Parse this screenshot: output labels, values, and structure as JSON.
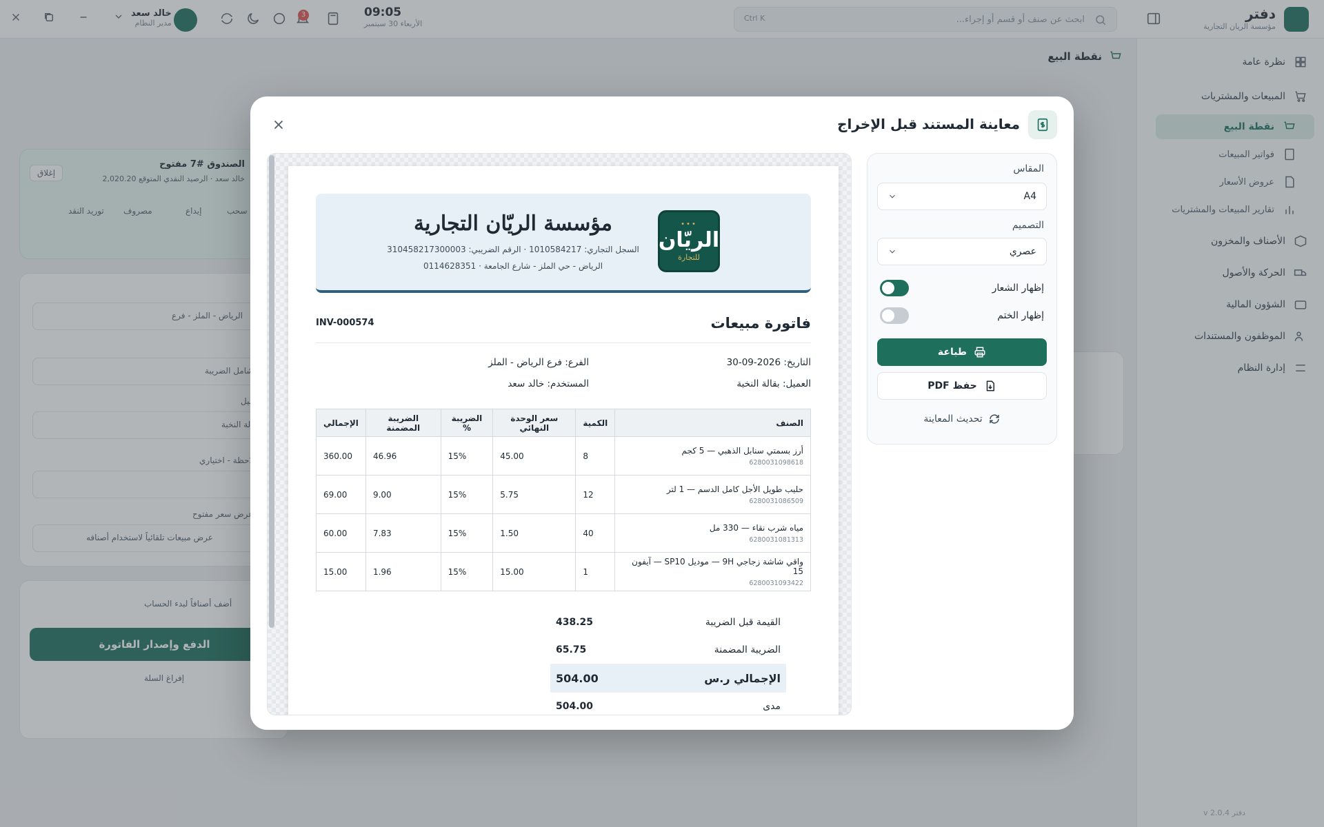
{
  "app": {
    "brand_name": "دفتر",
    "brand_sub": "مؤسسة الريان التجارية",
    "search_placeholder": "ابحث عن صنف أو قسم أو إجراء...",
    "search_shortcut": "Ctrl K",
    "clock_time": "09:05",
    "clock_date": "الأربعاء 30 سبتمبر",
    "user_name": "خالد سعد",
    "user_role": "مدير النظام",
    "notification_count": "3",
    "version": "v 2.0.4 دفتر"
  },
  "sidebar": {
    "items": [
      {
        "label": "نظرة عامة",
        "icon": "grid-icon"
      },
      {
        "label": "المبيعات والمشتريات",
        "icon": "cart-icon"
      },
      {
        "label": "نقطة البيع",
        "icon": "cart-icon"
      },
      {
        "label": "فواتير المبيعات",
        "icon": "receipt-icon"
      },
      {
        "label": "عروض الأسعار",
        "icon": "document-icon"
      },
      {
        "label": "تقارير المبيعات والمشتريات",
        "icon": "bar-chart-icon"
      },
      {
        "label": "الأصناف والمخزون",
        "icon": "box-icon"
      },
      {
        "label": "الحركة والأصول",
        "icon": "truck-icon"
      },
      {
        "label": "الشؤون المالية",
        "icon": "wallet-icon"
      },
      {
        "label": "الموظفون والمستندات",
        "icon": "users-icon"
      },
      {
        "label": "إدارة النظام",
        "icon": "sliders-icon"
      }
    ]
  },
  "background": {
    "page_title": "نقطة البيع",
    "cash_box_title": "الصندوق #7 مفتوح",
    "cash_box_sub": "خالد سعد · الرصيد النقدي المتوقع 2,020.20",
    "lock_label": "إغلاق",
    "actions": [
      "توريد النقد",
      "مصروف",
      "إيداع",
      "سحب"
    ],
    "branch_value": "الرياض - الملز - فرع",
    "tax_label": "شامل الضريبة",
    "customer_label": "العميل",
    "customer_value": "بقالة النخبة",
    "note_label": "ملاحظة - اختياري",
    "price_level": "عرض سعر مفتوح",
    "price_mode": "عرض مبيعات تلقائياً لاستخدام أصنافه",
    "pay_button": "الدفع وإصدار الفاتورة",
    "clear_cart": "إفراغ السلة",
    "hint": "أضف أصنافاً لبدء الحساب"
  },
  "modal": {
    "title": "معاينة المستند قبل الإخراج",
    "size_label": "المقاس",
    "size_value": "A4",
    "design_label": "التصميم",
    "design_value": "عصري",
    "show_logo_label": "إظهار الشعار",
    "show_logo": true,
    "show_stamp_label": "إظهار الختم",
    "show_stamp": false,
    "print_label": "طباعة",
    "pdf_label": "حفظ PDF",
    "refresh_label": "تحديث المعاينة"
  },
  "invoice": {
    "logo_word": "الريّان",
    "logo_sub": "للتجارة",
    "company_name": "مؤسسة الريّان التجارية",
    "company_reg": "السجل التجاري: 1010584217 · الرقم الضريبي: 310458217300003",
    "company_address": "الرياض - حي الملز - شارع الجامعة · 0114628351",
    "title": "فاتورة مبيعات",
    "number": "INV-000574",
    "date": "التاريخ: 2026-09-30",
    "branch": "الفرع: فرع الرياض - الملز",
    "customer": "العميل: بقالة النخبة",
    "user": "المستخدم: خالد سعد",
    "columns": [
      "الصنف",
      "الكمية",
      "سعر الوحدة النهائي",
      "الضريبة %",
      "الضريبة المضمنة",
      "الإجمالي"
    ],
    "rows": [
      {
        "name": "أرز بسمتي سنابل الذهبي — 5 كجم",
        "barcode": "6280031098618",
        "qty": "8",
        "unit_price": "45.00",
        "tax_pct": "15%",
        "tax": "46.96",
        "total": "360.00"
      },
      {
        "name": "حليب طويل الأجل كامل الدسم — 1 لتر",
        "barcode": "6280031086509",
        "qty": "12",
        "unit_price": "5.75",
        "tax_pct": "15%",
        "tax": "9.00",
        "total": "69.00"
      },
      {
        "name": "مياه شرب نقاء — 330 مل",
        "barcode": "6280031081313",
        "qty": "40",
        "unit_price": "1.50",
        "tax_pct": "15%",
        "tax": "7.83",
        "total": "60.00"
      },
      {
        "name": "واقي شاشة زجاجي 9H — موديل SP10 — آيفون 15",
        "barcode": "6280031093422",
        "qty": "1",
        "unit_price": "15.00",
        "tax_pct": "15%",
        "tax": "1.96",
        "total": "15.00"
      }
    ],
    "subtotal_label": "القيمة قبل الضريبة",
    "subtotal": "438.25",
    "tax_label": "الضريبة المضمنة",
    "tax_total": "65.75",
    "grand_label": "الإجمالي ر.س",
    "grand_total": "504.00",
    "payment_label": "مدى",
    "payment_value": "504.00"
  },
  "colors": {
    "brand": "#1e6f5c",
    "header_band": "#e8f0f7",
    "accent_line": "#2e5f7e"
  }
}
